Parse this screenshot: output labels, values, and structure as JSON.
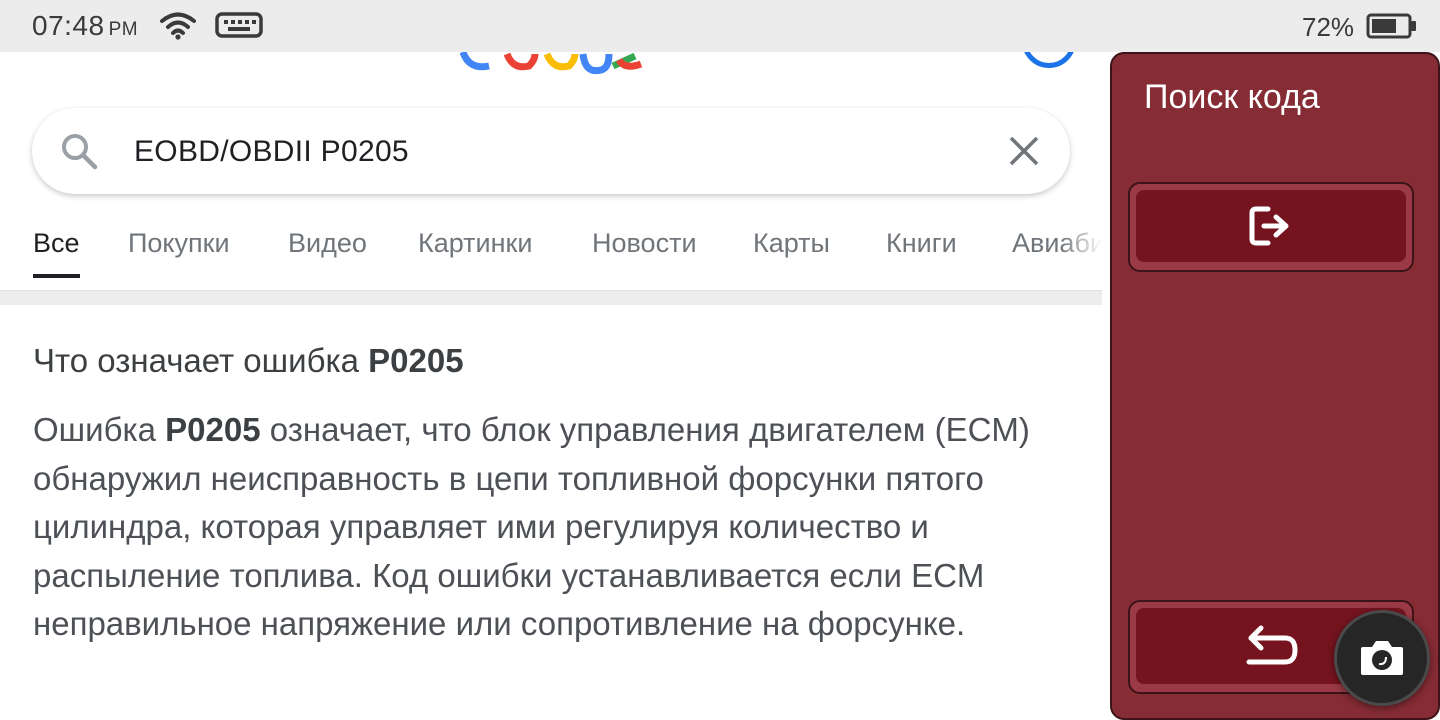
{
  "status_bar": {
    "time": "07:48",
    "ampm": "PM",
    "battery": "72%"
  },
  "browser": {
    "search": {
      "query": "EOBD/OBDII P0205"
    },
    "tabs": [
      {
        "label": "Все",
        "active": true
      },
      {
        "label": "Покупки"
      },
      {
        "label": "Видео"
      },
      {
        "label": "Картинки"
      },
      {
        "label": "Новости"
      },
      {
        "label": "Карты"
      },
      {
        "label": "Книги"
      },
      {
        "label": "Авиаби"
      }
    ],
    "result": {
      "heading_prefix": "Что означает ошибка ",
      "heading_code": "P0205",
      "answer_prefix": "Ошибка ",
      "answer_code": "P0205",
      "answer_text": " означает, что блок управления двигателем (ECM) обнаружил неисправность в цепи топливной форсунки пятого цилиндра, которая управляет ими регулируя количество и распыление топлива. Код ошибки устанавливается если ECM неправильное напряжение или сопротивление на форсунке."
    }
  },
  "panel": {
    "title": "Поиск кода",
    "buttons": [
      {
        "icon": "exit-icon"
      },
      {
        "icon": "back-arrow-icon"
      }
    ]
  },
  "fab": {
    "icon": "camera-icon"
  },
  "colors": {
    "panel_bg": "#862c35",
    "panel_button": "#75141f",
    "google_blue": "#4285f4",
    "google_red": "#ea4335",
    "google_yellow": "#fbbc05",
    "google_green": "#34a853"
  }
}
